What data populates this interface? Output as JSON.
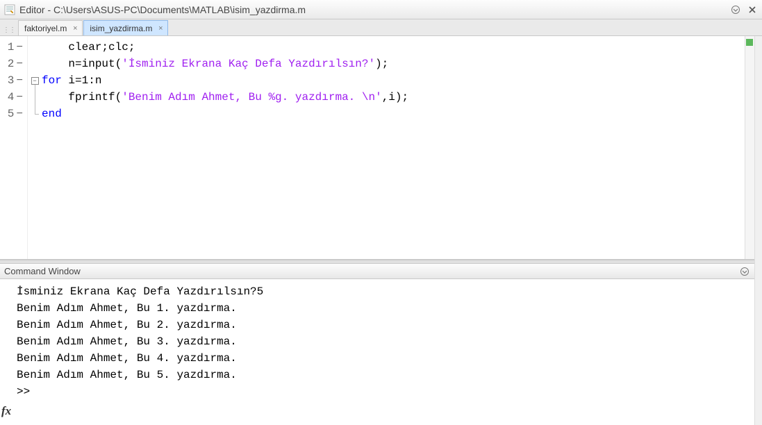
{
  "titlebar": {
    "title": "Editor - C:\\Users\\ASUS-PC\\Documents\\MATLAB\\isim_yazdirma.m"
  },
  "tabs": [
    {
      "label": "faktoriyel.m",
      "active": false
    },
    {
      "label": "isim_yazdirma.m",
      "active": true
    }
  ],
  "code": {
    "lines": [
      {
        "num": "1",
        "indent": "    ",
        "segs": [
          {
            "cls": "plain",
            "t": "clear;clc;"
          }
        ]
      },
      {
        "num": "2",
        "indent": "    ",
        "segs": [
          {
            "cls": "plain",
            "t": "n=input("
          },
          {
            "cls": "str",
            "t": "'İsminiz Ekrana Kaç Defa Yazdırılsın?'"
          },
          {
            "cls": "plain",
            "t": ");"
          }
        ]
      },
      {
        "num": "3",
        "indent": "",
        "segs": [
          {
            "cls": "kw",
            "t": "for"
          },
          {
            "cls": "plain",
            "t": " i=1:n"
          }
        ]
      },
      {
        "num": "4",
        "indent": "    ",
        "segs": [
          {
            "cls": "plain",
            "t": "fprintf("
          },
          {
            "cls": "str",
            "t": "'Benim Adım Ahmet, Bu %g. yazdırma. \\n'"
          },
          {
            "cls": "plain",
            "t": ",i);"
          }
        ]
      },
      {
        "num": "5",
        "indent": "",
        "segs": [
          {
            "cls": "kw",
            "t": "end"
          }
        ]
      }
    ]
  },
  "command_window": {
    "title": "Command Window",
    "lines": [
      "İsminiz Ekrana Kaç Defa Yazdırılsın?5",
      "Benim Adım Ahmet, Bu 1. yazdırma. ",
      "Benim Adım Ahmet, Bu 2. yazdırma. ",
      "Benim Adım Ahmet, Bu 3. yazdırma. ",
      "Benim Adım Ahmet, Bu 4. yazdırma. ",
      "Benim Adım Ahmet, Bu 5. yazdırma. "
    ],
    "prompt": ">>",
    "fx": "fx"
  }
}
